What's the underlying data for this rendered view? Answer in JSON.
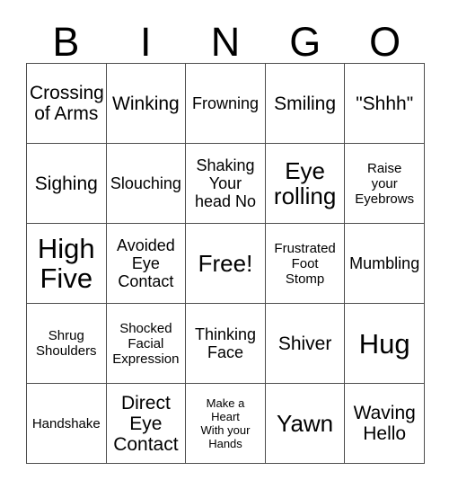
{
  "header": {
    "letters": [
      "B",
      "I",
      "N",
      "G",
      "O"
    ]
  },
  "grid": {
    "columns": 5,
    "rows": 5,
    "border_color": "#4d4d4d",
    "background_color": "#ffffff",
    "text_color": "#000000",
    "cells": [
      {
        "text": "Crossing\nof Arms",
        "size": "l"
      },
      {
        "text": "Winking",
        "size": "l"
      },
      {
        "text": "Frowning",
        "size": "m"
      },
      {
        "text": "Smiling",
        "size": "l"
      },
      {
        "text": "\"Shhh\"",
        "size": "l"
      },
      {
        "text": "Sighing",
        "size": "l"
      },
      {
        "text": "Slouching",
        "size": "m"
      },
      {
        "text": "Shaking\nYour\nhead No",
        "size": "m"
      },
      {
        "text": "Eye\nrolling",
        "size": "xl"
      },
      {
        "text": "Raise\nyour\nEyebrows",
        "size": "s"
      },
      {
        "text": "High\nFive",
        "size": "xxl"
      },
      {
        "text": "Avoided\nEye\nContact",
        "size": "m"
      },
      {
        "text": "Free!",
        "size": "xl"
      },
      {
        "text": "Frustrated\nFoot\nStomp",
        "size": "s"
      },
      {
        "text": "Mumbling",
        "size": "m"
      },
      {
        "text": "Shrug\nShoulders",
        "size": "s"
      },
      {
        "text": "Shocked\nFacial\nExpression",
        "size": "s"
      },
      {
        "text": "Thinking\nFace",
        "size": "m"
      },
      {
        "text": "Shiver",
        "size": "l"
      },
      {
        "text": "Hug",
        "size": "xxl"
      },
      {
        "text": "Handshake",
        "size": "s"
      },
      {
        "text": "Direct\nEye\nContact",
        "size": "l"
      },
      {
        "text": "Make a\nHeart\nWith your\nHands",
        "size": "xs"
      },
      {
        "text": "Yawn",
        "size": "xl"
      },
      {
        "text": "Waving\nHello",
        "size": "l"
      }
    ]
  }
}
